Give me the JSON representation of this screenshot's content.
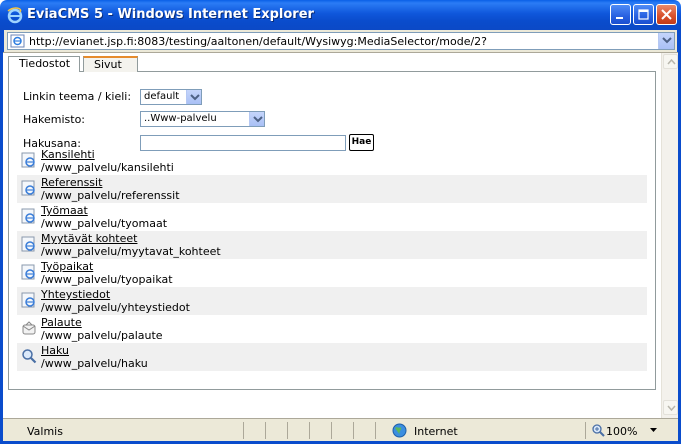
{
  "window": {
    "title": "EviaCMS 5 - Windows Internet Explorer",
    "url": "http://evianet.jsp.fi:8083/testing/aaltonen/default/Wysiwyg:MediaSelector/mode/2?"
  },
  "tabs": [
    {
      "label": "Tiedostot"
    },
    {
      "label": "Sivut"
    }
  ],
  "form": {
    "theme_label": "Linkin teema / kieli:",
    "theme_value": "default",
    "folder_label": "Hakemisto:",
    "folder_value": "..Www-palvelu",
    "search_label": "Hakusana:",
    "search_value": "",
    "search_button": "Hae"
  },
  "items": [
    {
      "title": "Kansilehti",
      "path": "/www_palvelu/kansilehti",
      "icon": "page-icon"
    },
    {
      "title": "Referenssit",
      "path": "/www_palvelu/referenssit",
      "icon": "page-icon"
    },
    {
      "title": "Työmaat",
      "path": "/www_palvelu/tyomaat",
      "icon": "page-icon"
    },
    {
      "title": "Myytävät kohteet",
      "path": "/www_palvelu/myytavat_kohteet",
      "icon": "page-icon"
    },
    {
      "title": "Työpaikat",
      "path": "/www_palvelu/tyopaikat",
      "icon": "page-icon"
    },
    {
      "title": "Yhteystiedot",
      "path": "/www_palvelu/yhteystiedot",
      "icon": "page-icon"
    },
    {
      "title": "Palaute",
      "path": "/www_palvelu/palaute",
      "icon": "feedback-icon"
    },
    {
      "title": "Haku",
      "path": "/www_palvelu/haku",
      "icon": "search-icon"
    }
  ],
  "status": {
    "text": "Valmis",
    "zone": "Internet",
    "zoom": "100%"
  },
  "colors": {
    "titlebar": "#0a4ccc",
    "tab_accent": "#e68b2c",
    "alt_row": "#f0f0f0"
  }
}
